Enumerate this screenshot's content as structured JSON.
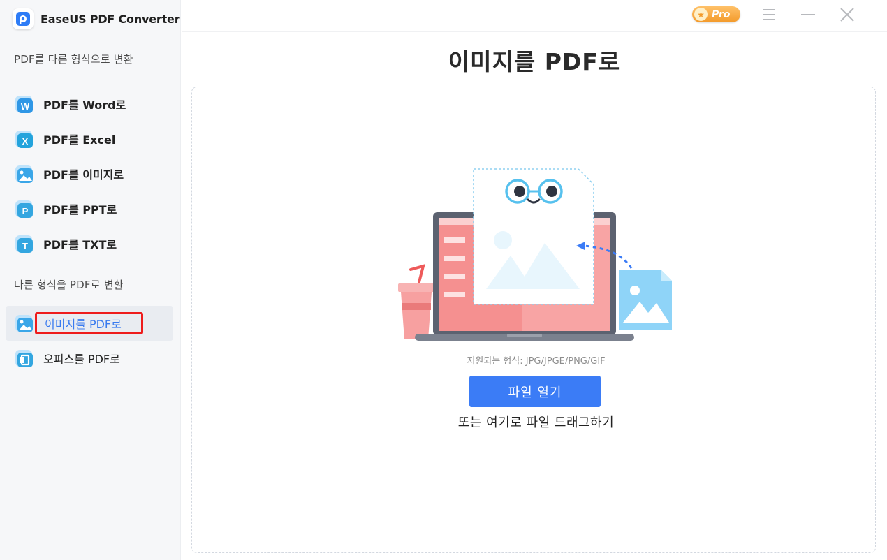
{
  "app": {
    "title": "EaseUS PDF Converter"
  },
  "sidebar": {
    "section_from_pdf": "PDF를 다른 형식으로 변환",
    "from_pdf_items": [
      {
        "label": "PDF를 Word로",
        "icon": "word-icon",
        "badge": "W",
        "color": "#2f8fe0"
      },
      {
        "label": "PDF를 Excel",
        "icon": "excel-icon",
        "badge": "X",
        "color": "#23a0dc"
      },
      {
        "label": "PDF를 이미지로",
        "icon": "image-icon",
        "badge": "",
        "color": "#3aa3e6"
      },
      {
        "label": "PDF를 PPT로",
        "icon": "ppt-icon",
        "badge": "P",
        "color": "#33a6e0"
      },
      {
        "label": "PDF를 TXT로",
        "icon": "txt-icon",
        "badge": "T",
        "color": "#33a6e0"
      }
    ],
    "section_to_pdf": "다른 형식을 PDF로 변환",
    "to_pdf_items": [
      {
        "label": "이미지를 PDF로",
        "icon": "image-to-pdf-icon",
        "active": true
      },
      {
        "label": "오피스를 PDF로",
        "icon": "office-icon",
        "badge": "O"
      }
    ]
  },
  "titlebar": {
    "pro_label": "Pro",
    "icons": [
      "star-icon",
      "menu-icon",
      "minimize-icon",
      "close-icon"
    ]
  },
  "main": {
    "title_prefix": "이미지를 ",
    "title_bold": "PDF",
    "title_suffix": "로",
    "supported_formats": "지원되는 형식: JPG/JPGE/PNG/GIF",
    "open_button": "파일 열기",
    "drag_hint": "또는 여기로 파일 드래그하기"
  },
  "colors": {
    "accent": "#3b7cf6",
    "highlight_red": "#ee1c1c",
    "pro_orange": "#f39a2a"
  }
}
